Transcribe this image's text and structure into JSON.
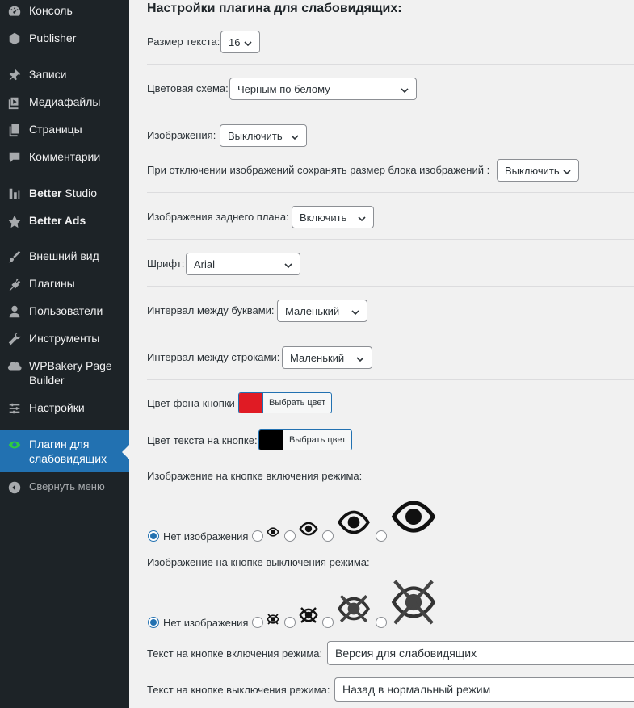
{
  "sidebar": {
    "items": [
      {
        "label": "Консоль",
        "icon": "dashboard-icon"
      },
      {
        "label": "Publisher",
        "icon": "publisher-icon"
      },
      {
        "label": "Записи",
        "icon": "pin-icon"
      },
      {
        "label": "Медиафайлы",
        "icon": "media-icon"
      },
      {
        "label": "Страницы",
        "icon": "pages-icon"
      },
      {
        "label": "Комментарии",
        "icon": "comments-icon"
      },
      {
        "label": "Better Studio",
        "bold": "Better",
        "rest": " Studio",
        "icon": "betterstudio-icon"
      },
      {
        "label": "Better Ads",
        "icon": "betterads-icon"
      },
      {
        "label": "Внешний вид",
        "icon": "brush-icon"
      },
      {
        "label": "Плагины",
        "icon": "plugin-icon"
      },
      {
        "label": "Пользователи",
        "icon": "user-icon"
      },
      {
        "label": "Инструменты",
        "icon": "wrench-icon"
      },
      {
        "label_line1": "WPBakery Page",
        "label_line2": "Builder",
        "icon": "wpbakery-icon"
      },
      {
        "label": "Настройки",
        "icon": "settings-icon"
      }
    ],
    "active": {
      "label_line1": "Плагин для",
      "label_line2": "слабовидящих",
      "icon": "eye-icon",
      "accent": "#2271b1"
    },
    "collapse": {
      "label": "Свернуть меню",
      "icon": "collapse-icon"
    }
  },
  "settings": {
    "title": "Настройки плагина для слабовидящих:",
    "font_size": {
      "label": "Размер текста:",
      "value": "16"
    },
    "color_scheme": {
      "label": "Цветовая схема:",
      "value": "Черным по белому"
    },
    "images": {
      "label": "Изображения:",
      "value": "Выключить"
    },
    "keep_size": {
      "label": "При отключении изображений сохранять размер блока изображений :",
      "value": "Выключить"
    },
    "bg_images": {
      "label": "Изображения заднего плана:",
      "value": "Включить"
    },
    "font": {
      "label": "Шрифт:",
      "value": "Arial"
    },
    "letter_spacing": {
      "label": "Интервал между буквами:",
      "value": "Маленький"
    },
    "line_spacing": {
      "label": "Интервал между строками:",
      "value": "Маленький"
    },
    "button_bg": {
      "label": "Цвет фона кнопки",
      "button": "Выбрать цвет",
      "color": "#e01b24"
    },
    "button_text": {
      "label": "Цвет текста на кнопке:",
      "button": "Выбрать цвет",
      "color": "#000000"
    },
    "on_image": {
      "label": "Изображение на кнопке включения режима:",
      "none_label": "Нет изображения"
    },
    "off_image": {
      "label": "Изображение на кнопке выключения режима:",
      "none_label": "Нет изображения"
    },
    "on_text": {
      "label": "Текст на кнопке включения режима:",
      "value": "Версия для слабовидящих"
    },
    "off_text": {
      "label": "Текст на кнопке выключения режима:",
      "value": "Назад в нормальный режим"
    }
  }
}
